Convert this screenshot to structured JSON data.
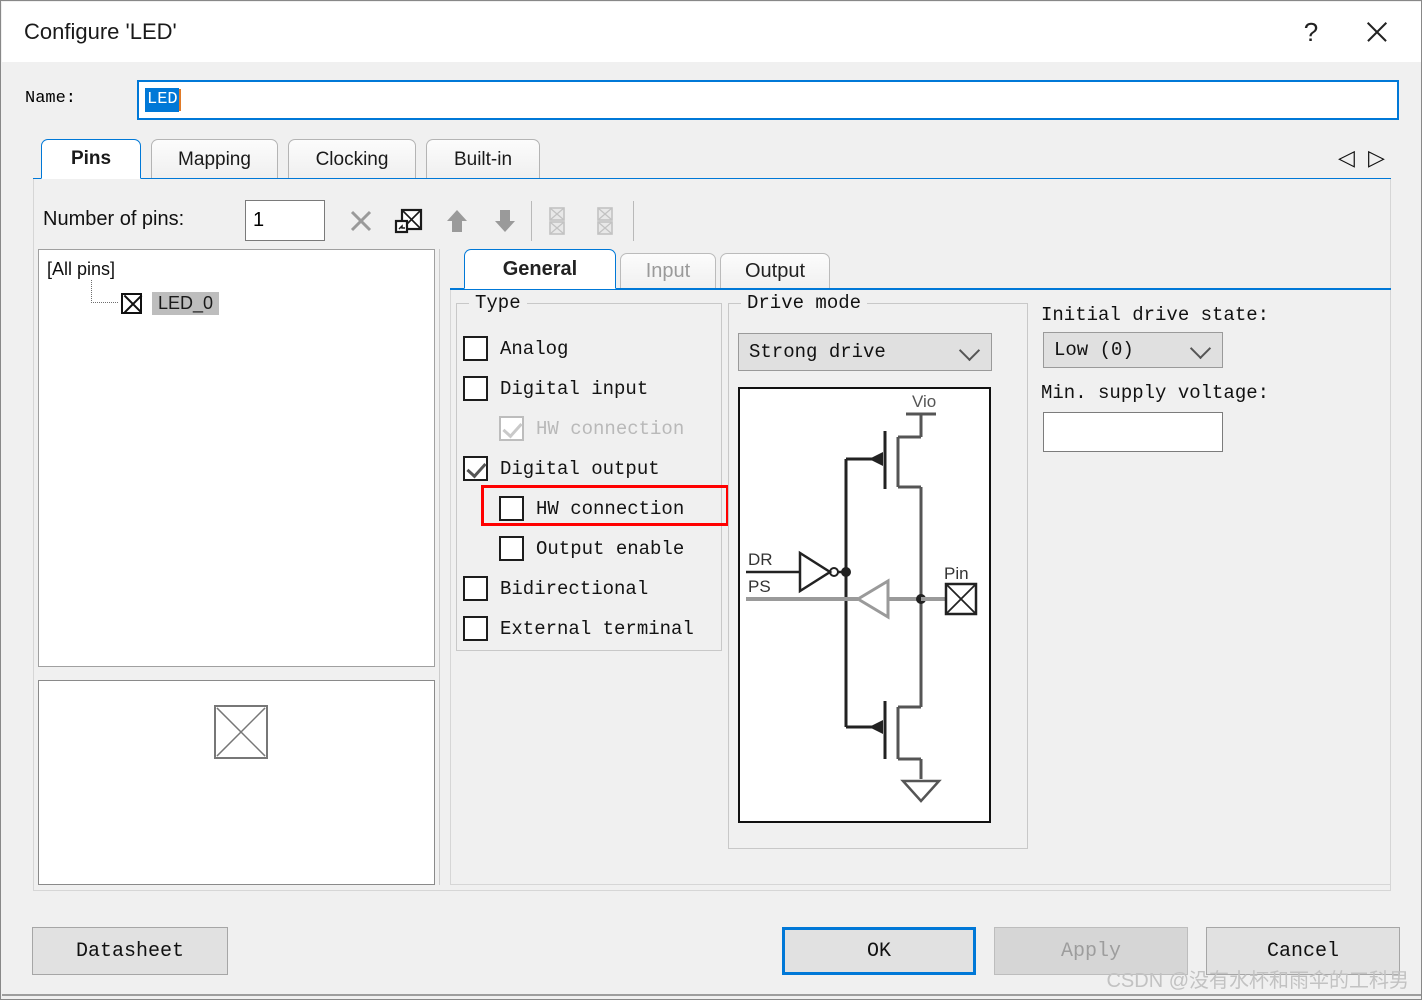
{
  "window": {
    "title": "Configure 'LED'",
    "help_icon": "?",
    "close_icon": "close-icon"
  },
  "name_row": {
    "label": "Name:",
    "value": "LED",
    "selected": true
  },
  "outer_tabs": [
    {
      "label": "Pins",
      "active": true
    },
    {
      "label": "Mapping",
      "active": false
    },
    {
      "label": "Clocking",
      "active": false
    },
    {
      "label": "Built-in",
      "active": false
    }
  ],
  "tab_nav": {
    "prev_icon": "◁",
    "next_icon": "▷"
  },
  "toolbar": {
    "pins_label": "Number of pins:",
    "pins_value": "1",
    "icons": [
      "delete-pin-icon",
      "add-pin-icon",
      "move-up-icon",
      "move-down-icon",
      "expand-pins-icon",
      "collapse-pins-icon"
    ]
  },
  "pin_tree": {
    "root": "[All pins]",
    "items": [
      {
        "label": "LED_0",
        "selected": true,
        "icon": "pin-symbol-icon"
      }
    ]
  },
  "preview": {
    "symbol": "pin-symbol-icon"
  },
  "inner_tabs": [
    {
      "label": "General",
      "active": true,
      "disabled": false
    },
    {
      "label": "Input",
      "active": false,
      "disabled": true
    },
    {
      "label": "Output",
      "active": false,
      "disabled": false
    }
  ],
  "type_group": {
    "title": "Type",
    "items": [
      {
        "label": "Analog",
        "checked": false,
        "disabled": false,
        "indent": 0,
        "highlight": false
      },
      {
        "label": "Digital input",
        "checked": false,
        "disabled": false,
        "indent": 0,
        "highlight": false
      },
      {
        "label": "HW connection",
        "checked": true,
        "disabled": true,
        "indent": 1,
        "highlight": false
      },
      {
        "label": "Digital output",
        "checked": true,
        "disabled": false,
        "indent": 0,
        "highlight": false
      },
      {
        "label": "HW connection",
        "checked": false,
        "disabled": false,
        "indent": 1,
        "highlight": true
      },
      {
        "label": "Output enable",
        "checked": false,
        "disabled": false,
        "indent": 1,
        "highlight": false
      },
      {
        "label": "Bidirectional",
        "checked": false,
        "disabled": false,
        "indent": 0,
        "highlight": false
      },
      {
        "label": "External terminal",
        "checked": false,
        "disabled": false,
        "indent": 0,
        "highlight": false
      }
    ]
  },
  "drive_mode_group": {
    "title": "Drive mode",
    "selected": "Strong drive",
    "chevron_icon": "chevron-down-icon",
    "diagram": {
      "vdd_label": "Vio",
      "input_labels": [
        "DR",
        "PS"
      ],
      "pin_label": "Pin",
      "pin_icon": "pin-symbol-icon"
    }
  },
  "right_panel": {
    "initial_drive_state_label": "Initial drive state:",
    "initial_drive_state_value": "Low (0)",
    "min_supply_voltage_label": "Min. supply voltage:",
    "min_supply_voltage_value": ""
  },
  "footer": {
    "datasheet_label": "Datasheet",
    "ok_label": "OK",
    "apply_label": "Apply",
    "apply_disabled": true,
    "cancel_label": "Cancel"
  },
  "watermark": {
    "text": "CSDN @没有水杯和雨伞的工科男"
  },
  "colors": {
    "accent": "#0078d7",
    "highlight": "#ff0000",
    "window_bg": "#f0f0f0"
  }
}
